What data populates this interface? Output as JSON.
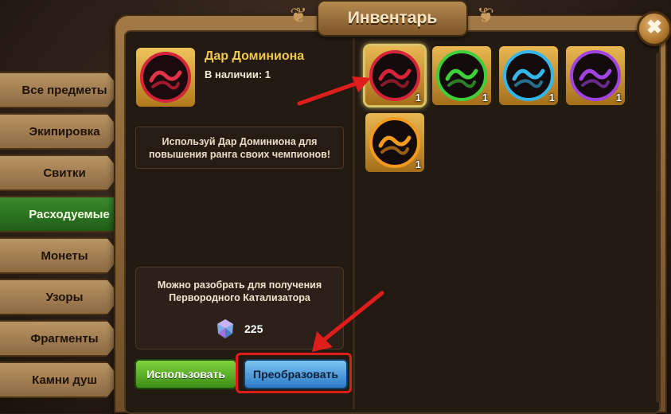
{
  "window": {
    "title": "Инвентарь",
    "close_label": "✖"
  },
  "sidebar": {
    "items": [
      {
        "label": "Все предметы",
        "active": false
      },
      {
        "label": "Экипировка",
        "active": false
      },
      {
        "label": "Свитки",
        "active": false
      },
      {
        "label": "Расходуемые",
        "active": true
      },
      {
        "label": "Монеты",
        "active": false
      },
      {
        "label": "Узоры",
        "active": false
      },
      {
        "label": "Фрагменты",
        "active": false
      },
      {
        "label": "Камни душ",
        "active": false
      }
    ]
  },
  "selected_item": {
    "name": "Дар Доминиона",
    "stock": "В наличии: 1",
    "description": "Используй Дар Доминиона для повышения ранга своих чемпионов!",
    "color": "#d4243a"
  },
  "disassemble": {
    "text": "Можно разобрать для получения Первородного Катализатора",
    "count": "225",
    "icon": "crystal-catalyst-icon"
  },
  "buttons": {
    "use": "Использовать",
    "convert": "Преобразовать"
  },
  "grid": {
    "items": [
      {
        "qty": "1",
        "color": "#d4243a",
        "selected": true
      },
      {
        "qty": "1",
        "color": "#3fcf3a",
        "selected": false
      },
      {
        "qty": "1",
        "color": "#34b6e8",
        "selected": false
      },
      {
        "qty": "1",
        "color": "#a043e0",
        "selected": false
      },
      {
        "qty": "1",
        "color": "#f29a1e",
        "selected": false
      }
    ]
  }
}
